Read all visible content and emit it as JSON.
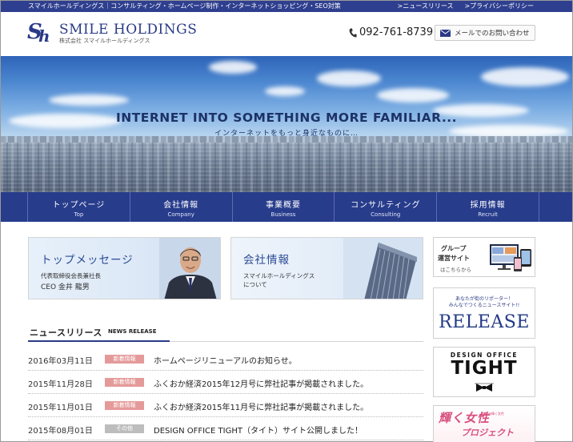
{
  "topbar": {
    "tagline": "スマイルホールディングス｜コンサルティング・ホームページ制作・インターネットショッピング・SEO対策",
    "links": [
      ">ニュースリリース",
      ">プライバシーポリシー"
    ]
  },
  "header": {
    "logo_mark": "Sh",
    "logo_title": "SMILE HOLDINGS",
    "logo_subtitle": "株式会社 スマイルホールディングス",
    "phone": "092-761-8739",
    "contact_button": "メールでのお問い合わせ"
  },
  "hero": {
    "title": "INTERNET INTO SOMETHING MORE FAMILIAR...",
    "subtitle": "インターネットをもっと身近なものに…"
  },
  "nav": {
    "items": [
      {
        "jp": "トップページ",
        "en": "Top"
      },
      {
        "jp": "会社情報",
        "en": "Company"
      },
      {
        "jp": "事業概要",
        "en": "Business"
      },
      {
        "jp": "コンサルティング",
        "en": "Consulting"
      },
      {
        "jp": "採用情報",
        "en": "Recruit"
      }
    ]
  },
  "cards": {
    "message": {
      "title": "トップメッセージ",
      "line1": "代表取締役会長兼社長",
      "line2": "CEO  金井 龍男"
    },
    "company": {
      "title": "会社情報",
      "line1": "スマイルホールディングス",
      "line2": "について"
    }
  },
  "sidebar": {
    "group": {
      "line1": "グループ",
      "line2": "運営サイト",
      "line3": "はこちらから"
    },
    "release": {
      "line1": "あなたが街のリポーター！",
      "line2": "みんなでつくるニュースサイト!!",
      "logo": "RELEASE"
    },
    "tight": {
      "line1": "DESIGN OFFICE",
      "line2": "TIGHT"
    },
    "women": {
      "line1": "輝く女性",
      "line2": "北九州輝く女性",
      "line3": "プロジェクト"
    }
  },
  "news": {
    "title": "ニュースリリース",
    "subtitle": "NEWS RELEASE",
    "items": [
      {
        "date": "2016年03月11日",
        "badge": "新着情報",
        "text": "ホームページリニューアルのお知らせ。",
        "kind": "new"
      },
      {
        "date": "2015年11月28日",
        "badge": "新着情報",
        "text": "ふくおか経済2015年12月号に弊社記事が掲載されました。",
        "kind": "new"
      },
      {
        "date": "2015年11月01日",
        "badge": "新着情報",
        "text": "ふくおか経済2015年11月号に弊社記事が掲載されました。",
        "kind": "new"
      },
      {
        "date": "2015年08月01日",
        "badge": "その他",
        "text": "DESIGN OFFICE TIGHT（タイト）サイト公開しました！",
        "kind": "other"
      }
    ]
  },
  "colors": {
    "brand_navy": "#283c8c",
    "badge_new": "#e59a9a",
    "badge_other": "#bdbdbd",
    "accent_pink": "#d94f7f"
  }
}
